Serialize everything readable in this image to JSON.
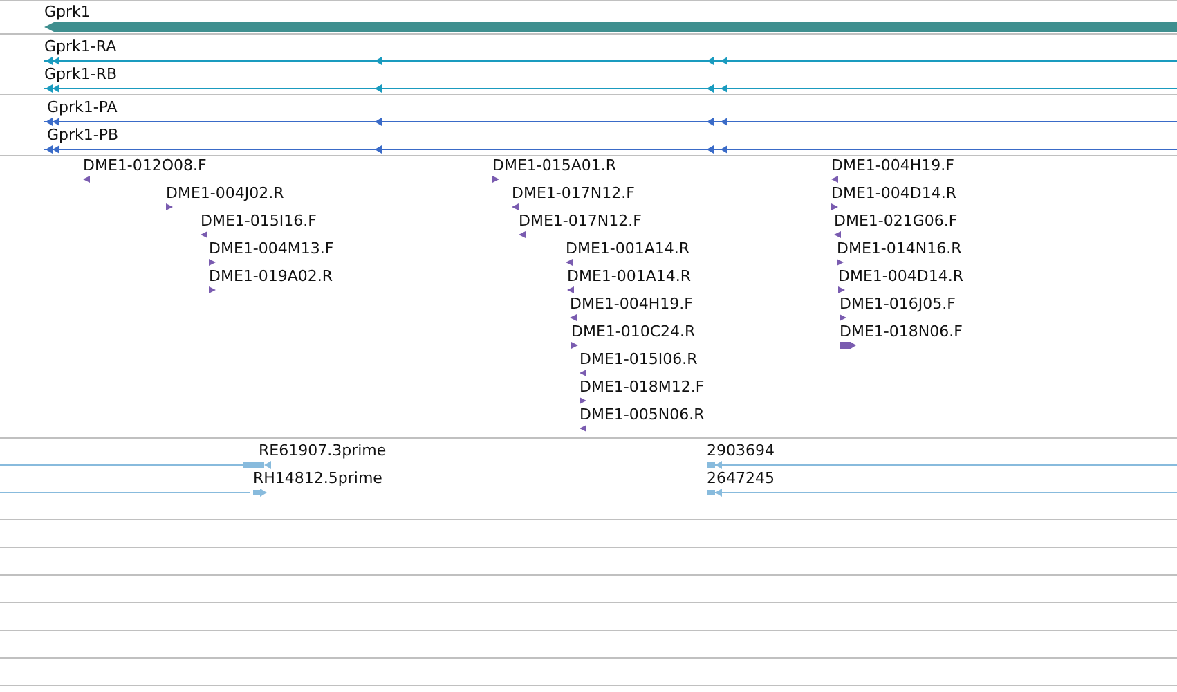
{
  "tracks": [
    {
      "kind": "gene",
      "features": [
        {
          "label": "Gprk1",
          "reverse": true
        }
      ]
    },
    {
      "kind": "transcript",
      "features": [
        {
          "label": "Gprk1-RA",
          "reverse": true
        },
        {
          "label": "Gprk1-RB",
          "reverse": true
        }
      ]
    },
    {
      "kind": "protein",
      "features": [
        {
          "label": "Gprk1-PA",
          "reverse": true
        },
        {
          "label": "Gprk1-PB",
          "reverse": true
        }
      ]
    },
    {
      "kind": "est",
      "features": [
        {
          "label": "DME1-012O08.F",
          "reverse": true
        },
        {
          "label": "DME1-004J02.R",
          "reverse": false
        },
        {
          "label": "DME1-015I16.F",
          "reverse": true
        },
        {
          "label": "DME1-004M13.F",
          "reverse": false
        },
        {
          "label": "DME1-019A02.R",
          "reverse": false
        },
        {
          "label": "DME1-015A01.R",
          "reverse": false
        },
        {
          "label": "DME1-017N12.F",
          "reverse": true
        },
        {
          "label": "DME1-017N12.F",
          "reverse": true
        },
        {
          "label": "DME1-001A14.R",
          "reverse": true
        },
        {
          "label": "DME1-001A14.R",
          "reverse": true
        },
        {
          "label": "DME1-004H19.F",
          "reverse": true
        },
        {
          "label": "DME1-010C24.R",
          "reverse": false
        },
        {
          "label": "DME1-015I06.R",
          "reverse": true
        },
        {
          "label": "DME1-018M12.F",
          "reverse": false
        },
        {
          "label": "DME1-005N06.R",
          "reverse": true
        },
        {
          "label": "DME1-004H19.F",
          "reverse": true
        },
        {
          "label": "DME1-004D14.R",
          "reverse": false
        },
        {
          "label": "DME1-021G06.F",
          "reverse": true
        },
        {
          "label": "DME1-014N16.R",
          "reverse": false
        },
        {
          "label": "DME1-004D14.R",
          "reverse": false
        },
        {
          "label": "DME1-016J05.F",
          "reverse": false
        },
        {
          "label": "DME1-018N06.F",
          "reverse": false
        }
      ]
    },
    {
      "kind": "cdna",
      "features": [
        {
          "label": "RE61907.3prime",
          "reverse": true
        },
        {
          "label": "2903694",
          "reverse": true
        },
        {
          "label": "RH14812.5prime",
          "reverse": false
        },
        {
          "label": "2647245",
          "reverse": true
        }
      ]
    }
  ]
}
